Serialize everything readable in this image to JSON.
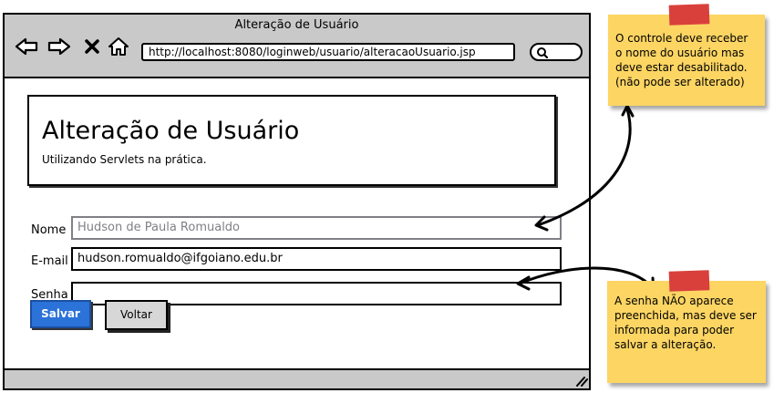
{
  "window": {
    "title": "Alteração de Usuário",
    "url": "http://localhost:8080/loginweb/usuario/alteracaoUsuario.jsp"
  },
  "icons": {
    "back": "arrow-left-icon",
    "forward": "arrow-right-icon",
    "stop": "close-icon",
    "home": "home-icon",
    "search": "search-icon",
    "resize": "resize-grip-icon"
  },
  "header": {
    "title": "Alteração de Usuário",
    "subtitle": "Utilizando Servlets na prática."
  },
  "form": {
    "nome_label": "Nome",
    "nome_value": "Hudson de Paula Romualdo",
    "email_label": "E-mail",
    "email_value": "hudson.romualdo@ifgoiano.edu.br",
    "senha_label": "Senha",
    "senha_value": "",
    "salvar_label": "Salvar",
    "voltar_label": "Voltar"
  },
  "notes": {
    "top": "O controle deve receber o nome do usuário mas deve estar desabilitado. (não pode ser alterado)",
    "bottom": "A senha NÃO aparece preenchida, mas deve ser informada para poder salvar a alteração."
  },
  "colors": {
    "primary_button": "#2b72d9",
    "disabled_text": "#7f7f86",
    "sticky_note": "#fcd563",
    "tape": "#d9403c",
    "chrome": "#c9c9c9"
  }
}
